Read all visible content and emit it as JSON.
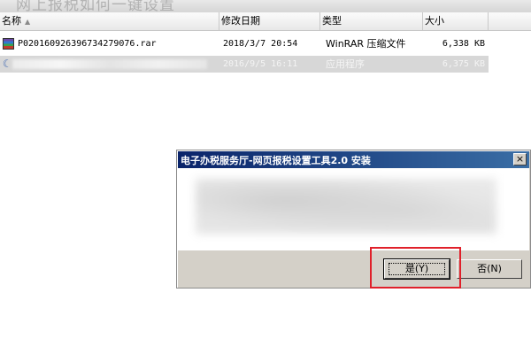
{
  "page_title_partial": "网上报税如何一键设置",
  "columns": {
    "name": "名称",
    "date": "修改日期",
    "type": "类型",
    "size": "大小"
  },
  "files": [
    {
      "name": "P020160926396734279076.rar",
      "date": "2018/3/7 20:54",
      "type": "WinRAR 压缩文件",
      "size": "6,338 KB",
      "icon": "rar-archive-icon"
    },
    {
      "name": "",
      "date": "2016/9/5 16:11",
      "type": "应用程序",
      "size": "6,375 KB",
      "icon": "application-icon"
    }
  ],
  "dialog": {
    "title": "电子办税服务厅-网页报税设置工具2.0 安装",
    "close_symbol": "×",
    "yes_button": "是(Y)",
    "no_button": "否(N)"
  },
  "colors": {
    "titlebar": "#0a246a",
    "highlight": "#e0202a"
  }
}
